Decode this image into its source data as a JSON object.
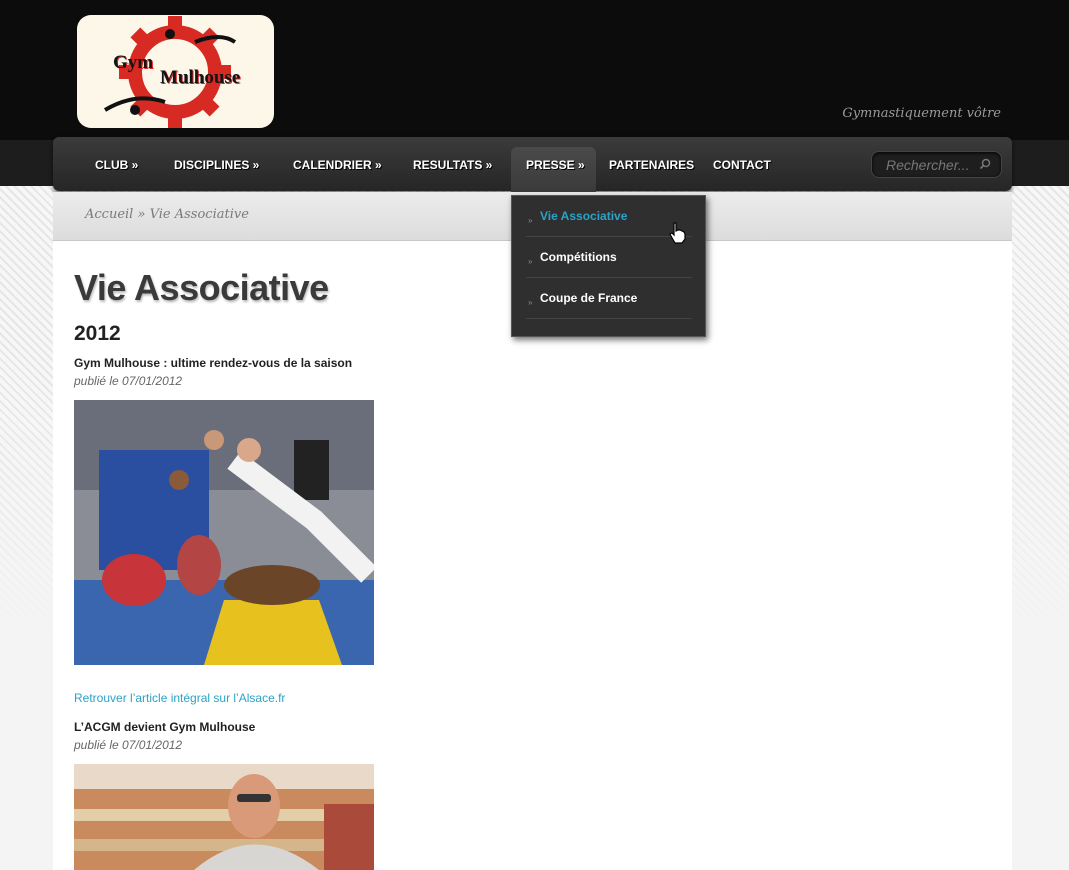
{
  "site": {
    "logo_line1": "Gym",
    "logo_line2": "Mulhouse",
    "tagline": "Gymnastiquement vôtre"
  },
  "nav": {
    "items": [
      {
        "label": "CLUB »"
      },
      {
        "label": "DISCIPLINES »"
      },
      {
        "label": "CALENDRIER »"
      },
      {
        "label": "RESULTATS »"
      },
      {
        "label": "PRESSE »"
      },
      {
        "label": "PARTENAIRES"
      },
      {
        "label": "CONTACT"
      }
    ],
    "active": "PRESSE »",
    "search_placeholder": "Rechercher..."
  },
  "dropdown": {
    "items": [
      {
        "label": "Vie Associative",
        "active": true
      },
      {
        "label": "Compétitions"
      },
      {
        "label": "Coupe de France"
      }
    ]
  },
  "breadcrumb": {
    "home": "Accueil",
    "separator": "»",
    "current": "Vie Associative"
  },
  "page": {
    "title": "Vie Associative",
    "year": "2012",
    "articles": [
      {
        "title": "Gym Mulhouse : ultime rendez-vous de la saison",
        "date": "publié le 07/01/2012",
        "link": "Retrouver l’article intégral sur l’Alsace.fr"
      },
      {
        "title": "L’ACGM devient Gym Mulhouse",
        "date": "publié le 07/01/2012"
      }
    ]
  },
  "colors": {
    "accent": "#2aa3c7",
    "header_bg": "#0c0c0c",
    "logo_red": "#d62a22"
  }
}
